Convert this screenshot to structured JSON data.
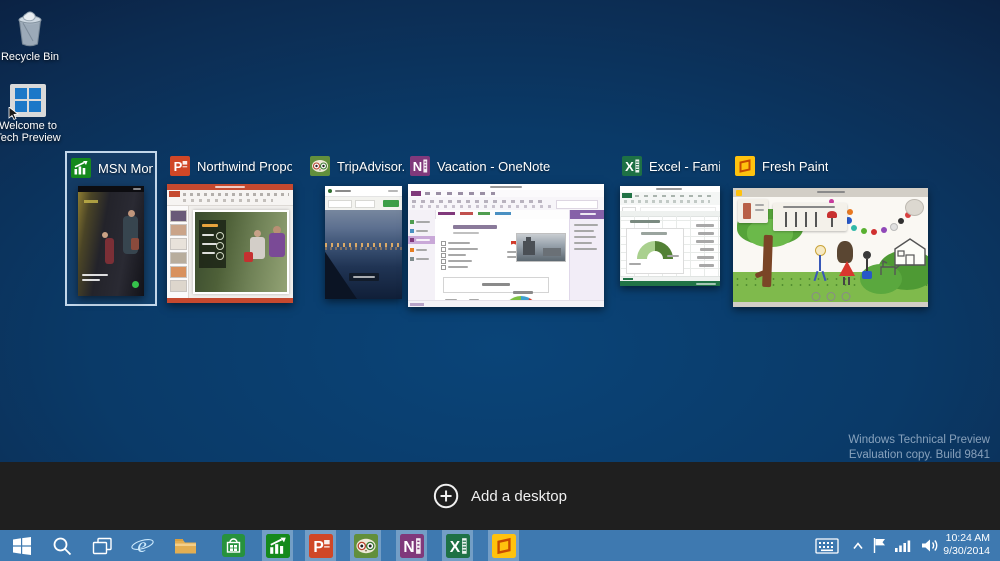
{
  "desktop": {
    "icons": [
      {
        "name": "recycle-bin",
        "label": "Recycle Bin"
      },
      {
        "name": "welcome-tech-preview",
        "label_line1": "Welcome to",
        "label_line2": "Tech Preview"
      }
    ],
    "watermark": {
      "line1": "Windows Technical Preview",
      "line2": "Evaluation copy. Build 9841"
    }
  },
  "task_view": {
    "add_desktop_label": "Add a desktop",
    "windows": [
      {
        "title": "MSN Mon...",
        "icon": "msn-money-icon",
        "selected": true
      },
      {
        "title": "Northwind Proposa...",
        "icon": "powerpoint-icon",
        "selected": false
      },
      {
        "title": "TripAdvisor...",
        "icon": "tripadvisor-icon",
        "selected": false
      },
      {
        "title": "Vacation - OneNote",
        "icon": "onenote-icon",
        "selected": false
      },
      {
        "title": "Excel - Family...",
        "icon": "excel-icon",
        "selected": false
      },
      {
        "title": "Fresh Paint",
        "icon": "fresh-paint-icon",
        "selected": false
      }
    ]
  },
  "taskbar": {
    "system_icons": [
      "start-icon",
      "search-icon",
      "task-view-icon",
      "internet-explorer-icon",
      "file-explorer-icon",
      "store-icon"
    ],
    "running_app_icons": [
      "msn-money-icon",
      "powerpoint-icon",
      "tripadvisor-icon",
      "onenote-icon",
      "excel-icon",
      "fresh-paint-icon"
    ],
    "tray_icons": [
      "keyboard-icon",
      "chevron-up-icon",
      "flag-icon",
      "network-icon",
      "volume-icon"
    ],
    "clock": {
      "time": "10:24 AM",
      "date": "9/30/2014"
    }
  },
  "colors": {
    "taskbar": "#3e79b0",
    "selection_border": "#c3d7ea",
    "add_desktop_bar": "#1f1f1f",
    "wallpaper_center": "#0a4478",
    "wallpaper_edge": "#0a1d3c"
  }
}
